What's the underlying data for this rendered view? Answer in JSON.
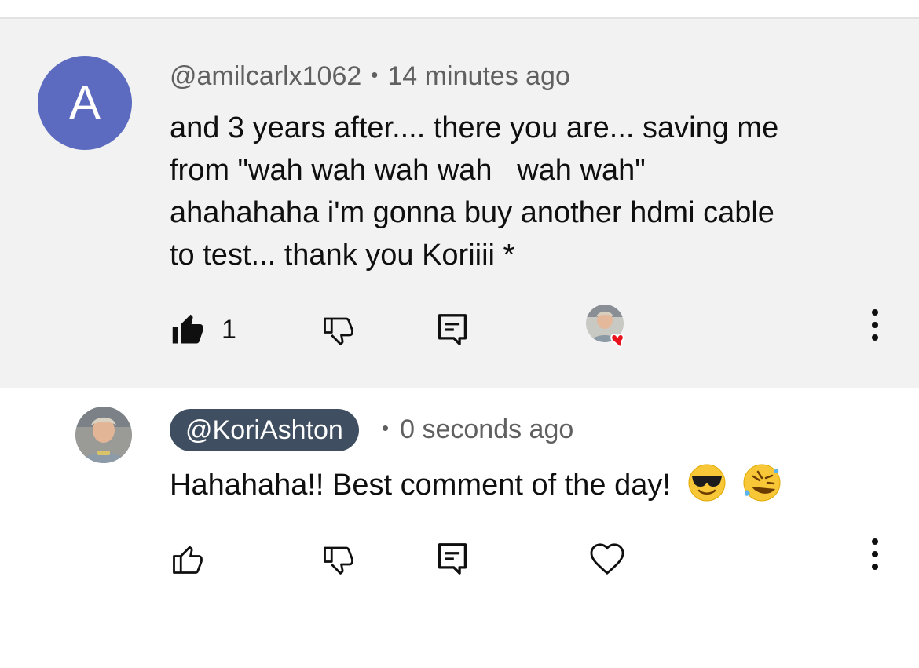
{
  "comment": {
    "author_initial": "A",
    "author": "@amilcarlx1062",
    "separator": "•",
    "time": "14 minutes ago",
    "text": "and 3 years after.... there you are... saving me\nfrom \"wah wah wah wah   wah wah\"\nahahahaha i'm gonna buy another hdmi cable\nto test... thank you Koriiii *",
    "like_count": "1",
    "liked": true,
    "creator_hearted": true,
    "avatar_color": "#5c6bc0",
    "heart_color": "#e8131c"
  },
  "reply": {
    "author": "@KoriAshton",
    "separator": "•",
    "time": "0 seconds ago",
    "text": "Hahahaha!! Best comment of the day!",
    "emojis": [
      "smiling-face-with-sunglasses",
      "rolling-on-the-floor-laughing"
    ],
    "badge_color": "#3f4f61"
  },
  "icons": [
    "thumbs-up-icon",
    "thumbs-down-icon",
    "reply-icon",
    "heart-icon",
    "more-vert-icon"
  ]
}
